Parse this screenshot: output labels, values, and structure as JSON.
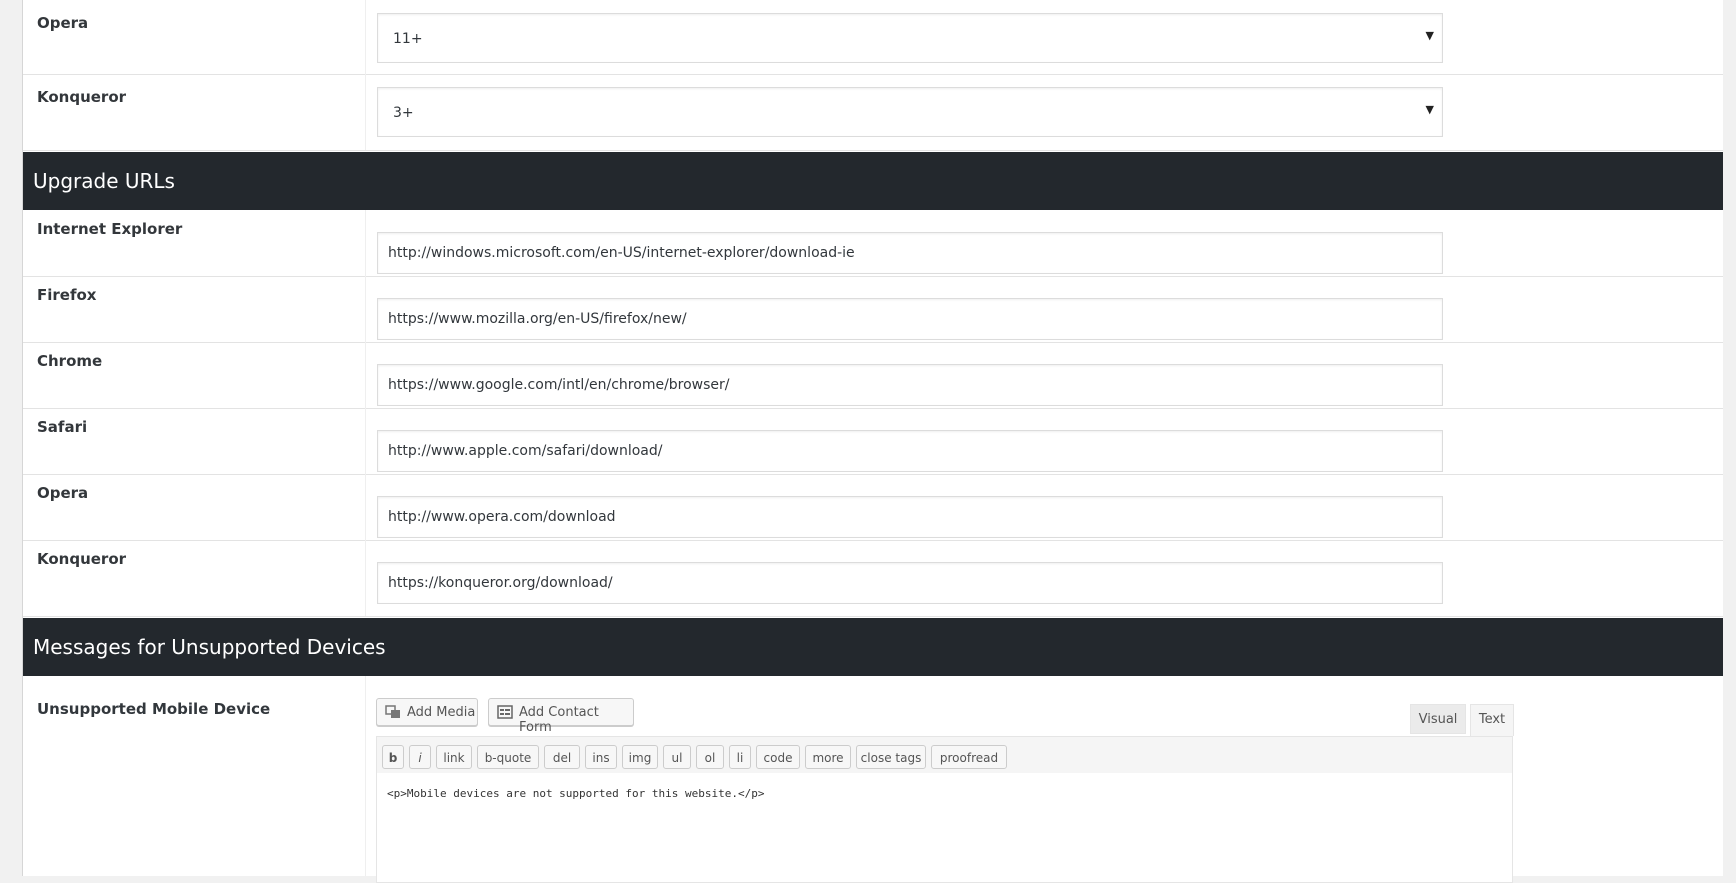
{
  "version_rows": [
    {
      "browser": "Opera",
      "selected": "11+"
    },
    {
      "browser": "Konqueror",
      "selected": "3+"
    }
  ],
  "upgrade_section": {
    "title": "Upgrade URLs",
    "rows": [
      {
        "browser": "Internet Explorer",
        "url": "http://windows.microsoft.com/en-US/internet-explorer/download-ie"
      },
      {
        "browser": "Firefox",
        "url": "https://www.mozilla.org/en-US/firefox/new/"
      },
      {
        "browser": "Chrome",
        "url": "https://www.google.com/intl/en/chrome/browser/"
      },
      {
        "browser": "Safari",
        "url": "http://www.apple.com/safari/download/"
      },
      {
        "browser": "Opera",
        "url": "http://www.opera.com/download"
      },
      {
        "browser": "Konqueror",
        "url": "https://konqueror.org/download/"
      }
    ]
  },
  "messages_section": {
    "title": "Messages for Unsupported Devices",
    "field_label": "Unsupported Mobile Device",
    "add_media": "Add Media",
    "add_contact_form": "Add Contact Form",
    "tabs": {
      "visual": "Visual",
      "text": "Text"
    },
    "quicktags": [
      "b",
      "i",
      "link",
      "b-quote",
      "del",
      "ins",
      "img",
      "ul",
      "ol",
      "li",
      "code",
      "more",
      "close tags",
      "proofread"
    ],
    "content": "<p>Mobile devices are not supported for this website.</p>"
  },
  "icons": {
    "select_arrow": "dropdown-arrow-icon",
    "media": "add-media-icon",
    "form": "contact-form-icon"
  }
}
